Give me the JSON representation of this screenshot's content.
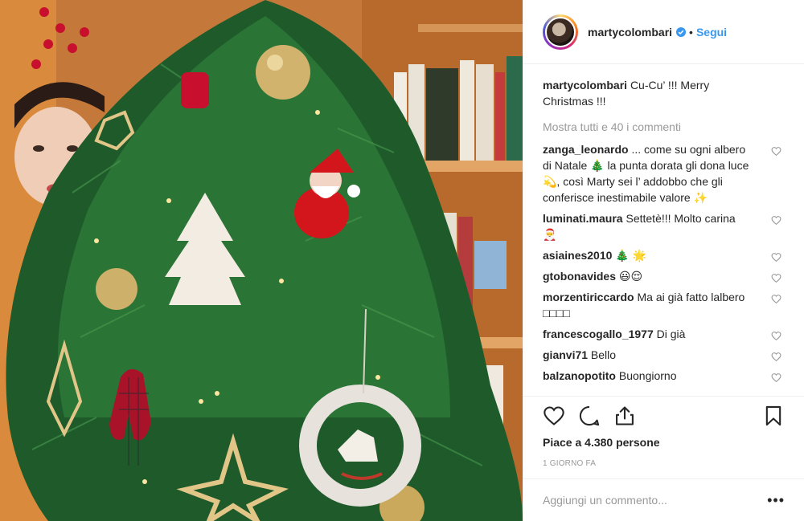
{
  "post": {
    "username": "martycolombari",
    "follow_label": "Segui",
    "separator": "•",
    "caption_text": "Cu-Cu’ !!! Merry Christmas !!!",
    "show_all_comments": "Mostra tutti e 40 i commenti",
    "likes_text": "Piace a 4.380 persone",
    "date_text": "1 GIORNO FA",
    "add_comment_placeholder": "Aggiungi un commento...",
    "more_label": "•••"
  },
  "comments": [
    {
      "user": "zanga_leonardo",
      "text": "... come su ogni albero di Natale 🎄 la punta dorata gli dona luce 💫, così Marty sei l’ addobbo che gli conferisce inestimabile valore ✨"
    },
    {
      "user": "luminati.maura",
      "text": "Settetè!!! Molto carina 🎅"
    },
    {
      "user": "asiaines2010",
      "text": "🎄 🌟"
    },
    {
      "user": "gtobonavides",
      "text": "😃😌"
    },
    {
      "user": "morzentiriccardo",
      "text": "Ma ai già fatto lalbero □□□□"
    },
    {
      "user": "francescogallo_1977",
      "text": "Di già"
    },
    {
      "user": "gianvi71",
      "text": "Bello"
    },
    {
      "user": "balzanopotito",
      "text": "Buongiorno"
    }
  ],
  "icons": {
    "verified": "verified-badge-icon",
    "like": "heart-icon",
    "comment": "comment-icon",
    "share": "share-icon",
    "save": "bookmark-icon"
  },
  "colors": {
    "link_blue": "#3897f0",
    "verified_blue": "#3897f0",
    "muted": "#999999",
    "border": "#efefef"
  }
}
